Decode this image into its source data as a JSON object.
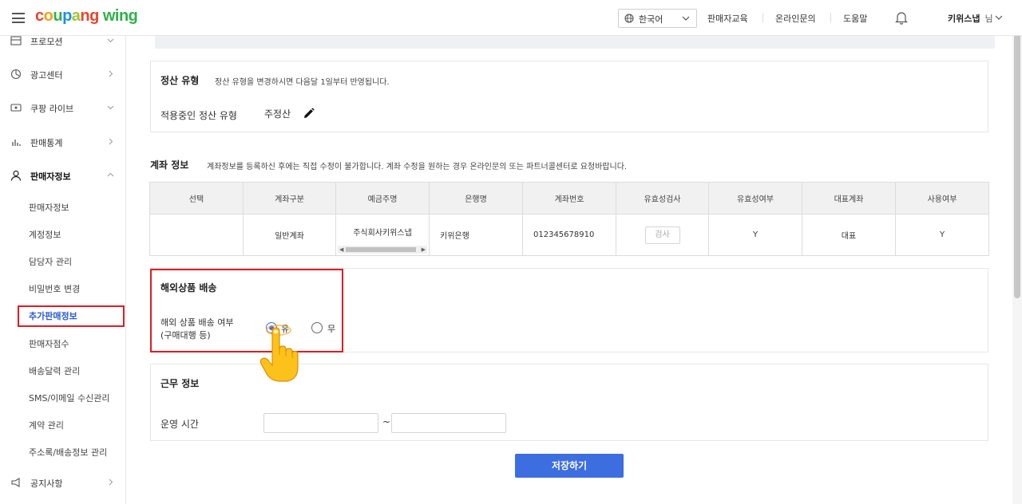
{
  "header": {
    "logo_parts": [
      "c",
      "o",
      "u",
      "p",
      "a",
      "ng"
    ],
    "logo_wing": "wing",
    "language": "한국어",
    "links": [
      "판매자교육",
      "온라인문의",
      "도움말"
    ],
    "user_name": "키위스냅",
    "user_suffix": "님"
  },
  "sidebar": {
    "items": [
      {
        "label": "프로모션"
      },
      {
        "label": "광고센터"
      },
      {
        "label": "쿠팡 라이브"
      },
      {
        "label": "판매통계"
      },
      {
        "label": "판매자정보"
      },
      {
        "label": "공지사항"
      }
    ],
    "subitems": [
      "판매자정보",
      "계정정보",
      "담당자 관리",
      "비밀번호 변경",
      "추가판매정보",
      "판매자점수",
      "배송달력 관리",
      "SMS/이메일 수신관리",
      "계약 관리",
      "주소록/배송정보 관리"
    ],
    "current_subitem": "추가판매정보"
  },
  "settlement": {
    "title": "정산 유형",
    "desc": "정산 유형을 변경하시면 다음달 1일부터 반영됩니다.",
    "label": "적용중인 정산 유형",
    "value": "주정산"
  },
  "account": {
    "title": "계좌 정보",
    "desc": "계좌정보를 등록하신 후에는 직접 수정이 불가합니다. 계좌 수정을 원하는 경우 온라인문의 또는 파트너콜센터로 요청바랍니다.",
    "columns": [
      "선택",
      "계좌구분",
      "예금주명",
      "은행명",
      "계좌번호",
      "유효성검사",
      "유효성여부",
      "대표계좌",
      "사용여부"
    ],
    "row": {
      "select": "",
      "type": "일반계좌",
      "holder": "주식회사키위스냅",
      "bank": "키위은행",
      "number": "012345678910",
      "verify_button": "검사",
      "valid": "Y",
      "primary": "대표",
      "in_use": "Y"
    }
  },
  "overseas": {
    "title": "해외상품 배송",
    "label_line1": "해외 상품 배송 여부",
    "label_line2": "(구매대행 등)",
    "options": [
      "유",
      "무"
    ],
    "selected": "유"
  },
  "work": {
    "title": "근무 정보",
    "hours_label": "운영 시간",
    "start_value": "",
    "end_value": "",
    "separator": "~"
  },
  "save_label": "저장하기"
}
